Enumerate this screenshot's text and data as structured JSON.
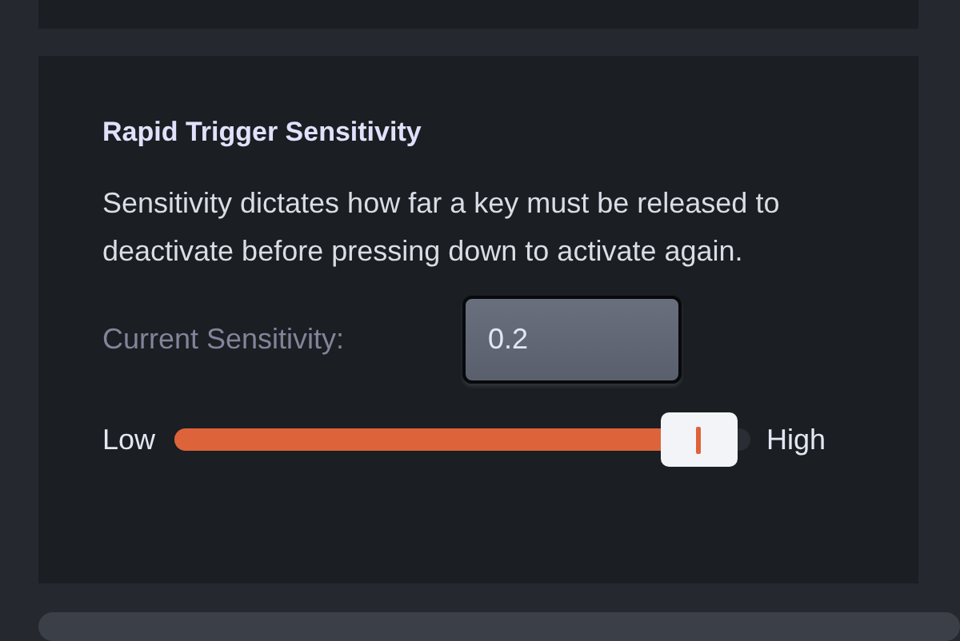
{
  "section": {
    "title": "Rapid Trigger Sensitivity",
    "description": "Sensitivity dictates how far a key must be released to deactivate before pressing down to activate again.",
    "field": {
      "label": "Current Sensitivity:",
      "value": "0.2"
    },
    "slider": {
      "min_label": "Low",
      "max_label": "High",
      "level": 0.91
    }
  }
}
